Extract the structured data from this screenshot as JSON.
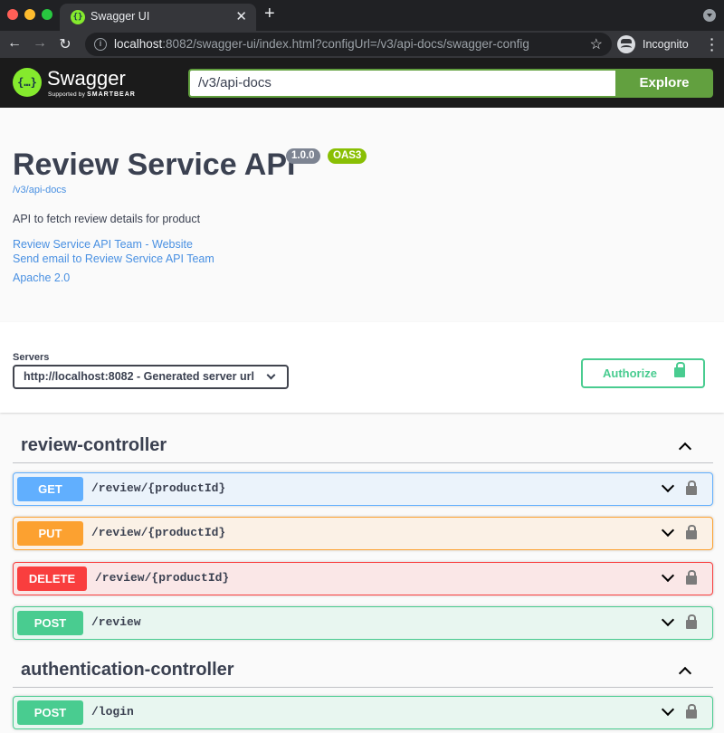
{
  "browser": {
    "tab_title": "Swagger UI",
    "tab_close": "✕",
    "new_tab": "+",
    "url_host": "localhost",
    "url_rest": ":8082/swagger-ui/index.html?configUrl=/v3/api-docs/swagger-config",
    "profile_label": "Incognito",
    "traffic_colors": [
      "#ff5f57",
      "#febc2e",
      "#28c840"
    ]
  },
  "topbar": {
    "logo_text": "Swagger",
    "logo_sub_prefix": "Supported by",
    "logo_sub_brand": "SMARTBEAR",
    "spec_url_value": "/v3/api-docs",
    "explore_label": "Explore"
  },
  "info": {
    "title": "Review Service API",
    "version": "1.0.0",
    "oas_badge": "OAS3",
    "spec_link": "/v3/api-docs",
    "description": "API to fetch review details for product",
    "links": [
      "Review Service API Team - Website",
      "Send email to Review Service API Team",
      "Apache 2.0"
    ]
  },
  "servers": {
    "label": "Servers",
    "selected": "http://localhost:8082 - Generated server url",
    "authorize_label": "Authorize"
  },
  "tags": [
    {
      "name": "review-controller",
      "operations": [
        {
          "method": "GET",
          "path": "/review/{productId}"
        },
        {
          "method": "PUT",
          "path": "/review/{productId}"
        },
        {
          "method": "DELETE",
          "path": "/review/{productId}"
        },
        {
          "method": "POST",
          "path": "/review"
        }
      ]
    },
    {
      "name": "authentication-controller",
      "operations": [
        {
          "method": "POST",
          "path": "/login"
        }
      ]
    }
  ],
  "colors": {
    "get": "#61affe",
    "put": "#fca130",
    "delete": "#f93e3e",
    "post": "#49cc90",
    "brand": "#85ea2d",
    "explore": "#62a03f"
  }
}
